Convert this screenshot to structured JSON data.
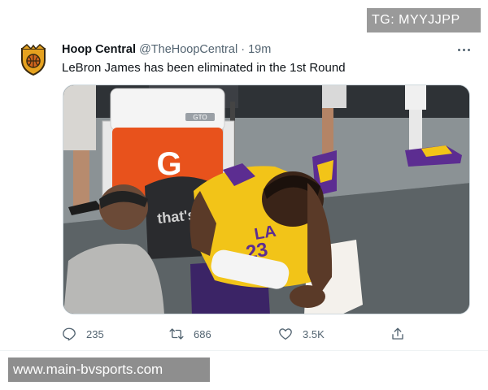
{
  "overlay": {
    "tg_badge": "TG: MYYJJPP",
    "watermark": "www.main-bvsports.com"
  },
  "tweet": {
    "author_name": "Hoop Central",
    "author_handle": "@TheHoopCentral",
    "separator": "·",
    "time": "19m",
    "text": "LeBron James has been eliminated in the 1st Round",
    "media": {
      "cooler_logo": "G",
      "cooler_badge": "GTO",
      "chair_text": "that's g",
      "jersey_team": "LA",
      "jersey_number": "23"
    },
    "actions": {
      "replies": "235",
      "retweets": "686",
      "likes": "3.5K"
    }
  },
  "colors": {
    "text_primary": "#0f1419",
    "text_secondary": "#536471",
    "cooler_orange": "#e8521c",
    "jersey_gold": "#f2c418",
    "lakers_purple": "#552583"
  },
  "icons": {
    "avatar": "hoop-central-crest-icon",
    "more": "more-horizontal-icon",
    "reply": "reply-icon",
    "retweet": "retweet-icon",
    "like": "heart-icon",
    "share": "share-icon"
  }
}
